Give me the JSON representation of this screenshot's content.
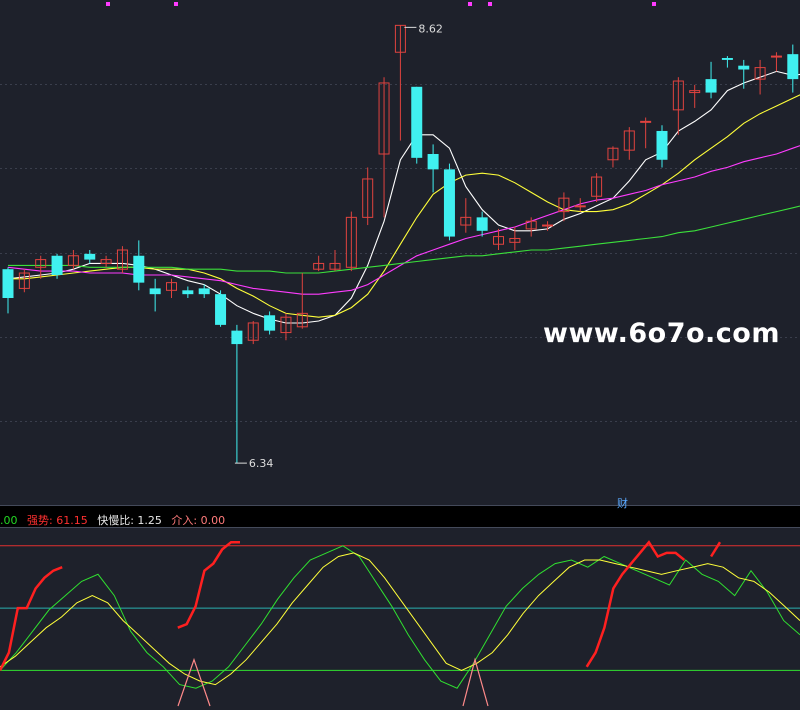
{
  "watermark": "www.6o7o.com",
  "main_panel": {
    "high_label": "8.62",
    "low_label": "6.34",
    "marker_label": "财",
    "marker_color": "#5aa9ff"
  },
  "indicator_panel": {
    "legend": [
      {
        "text": ".00",
        "color": "#23d723"
      },
      {
        "text": "强势: 61.15",
        "color": "#ff3030"
      },
      {
        "text": "快慢比: 1.25",
        "color": "#e8e8e8"
      },
      {
        "text": "介入: 0.00",
        "color": "#ff7b7b"
      }
    ]
  },
  "colors": {
    "background": "#000000",
    "bg_main": "#1e212b",
    "up": "#e0433f",
    "down": "#40f0f0",
    "ma5": "#ffffff",
    "ma10": "#ffff3a",
    "ma20": "#ff3cff",
    "ma60": "#3be03b",
    "strong": "#ff2020",
    "signal": "#ffff3a",
    "fast": "#30e030",
    "entry": "#ff8a8a",
    "hline_top": "#e03030",
    "hline_mid": "#2ab0b0",
    "hline_low": "#30e030"
  },
  "chart_data": {
    "type": "candlestick",
    "ylim": [
      6.2,
      8.7
    ],
    "candles": [
      [
        7.35,
        7.2,
        7.36,
        7.12
      ],
      [
        7.25,
        7.33,
        7.35,
        7.23
      ],
      [
        7.36,
        7.4,
        7.42,
        7.3
      ],
      [
        7.42,
        7.32,
        7.43,
        7.3
      ],
      [
        7.37,
        7.42,
        7.45,
        7.35
      ],
      [
        7.43,
        7.4,
        7.45,
        7.38
      ],
      [
        7.38,
        7.4,
        7.42,
        7.36
      ],
      [
        7.35,
        7.45,
        7.47,
        7.33
      ],
      [
        7.42,
        7.28,
        7.5,
        7.24
      ],
      [
        7.25,
        7.22,
        7.3,
        7.13
      ],
      [
        7.24,
        7.28,
        7.3,
        7.2
      ],
      [
        7.24,
        7.22,
        7.26,
        7.2
      ],
      [
        7.25,
        7.22,
        7.27,
        7.2
      ],
      [
        7.22,
        7.06,
        7.24,
        7.05
      ],
      [
        7.03,
        6.96,
        7.06,
        6.34
      ],
      [
        6.98,
        7.07,
        7.08,
        6.96
      ],
      [
        7.11,
        7.03,
        7.13,
        7.01
      ],
      [
        7.02,
        7.1,
        7.12,
        6.98
      ],
      [
        7.05,
        7.12,
        7.33,
        7.04
      ],
      [
        7.35,
        7.38,
        7.42,
        7.34
      ],
      [
        7.35,
        7.38,
        7.45,
        7.34
      ],
      [
        7.36,
        7.62,
        7.65,
        7.34
      ],
      [
        7.62,
        7.82,
        7.88,
        7.58
      ],
      [
        7.95,
        8.32,
        8.35,
        7.62
      ],
      [
        8.48,
        8.62,
        8.62,
        8.02
      ],
      [
        8.3,
        7.93,
        8.3,
        7.9
      ],
      [
        7.95,
        7.87,
        8.0,
        7.75
      ],
      [
        7.87,
        7.52,
        7.9,
        7.5
      ],
      [
        7.58,
        7.62,
        7.72,
        7.54
      ],
      [
        7.62,
        7.55,
        7.65,
        7.52
      ],
      [
        7.48,
        7.52,
        7.56,
        7.45
      ],
      [
        7.49,
        7.51,
        7.57,
        7.45
      ],
      [
        7.56,
        7.6,
        7.62,
        7.52
      ],
      [
        7.58,
        7.58,
        7.6,
        7.55
      ],
      [
        7.65,
        7.72,
        7.75,
        7.6
      ],
      [
        7.68,
        7.68,
        7.72,
        7.65
      ],
      [
        7.73,
        7.83,
        7.85,
        7.7
      ],
      [
        7.92,
        7.98,
        7.99,
        7.88
      ],
      [
        7.97,
        8.07,
        8.09,
        7.92
      ],
      [
        8.12,
        8.12,
        8.14,
        7.98
      ],
      [
        8.07,
        7.92,
        8.1,
        7.88
      ],
      [
        8.18,
        8.33,
        8.35,
        8.05
      ],
      [
        8.27,
        8.28,
        8.31,
        8.19
      ],
      [
        8.34,
        8.27,
        8.43,
        8.24
      ],
      [
        8.45,
        8.44,
        8.46,
        8.4
      ],
      [
        8.41,
        8.39,
        8.44,
        8.29
      ],
      [
        8.34,
        8.4,
        8.44,
        8.26
      ],
      [
        8.46,
        8.46,
        8.48,
        8.38
      ],
      [
        8.47,
        8.34,
        8.52,
        8.27
      ],
      [
        8.41,
        8.41,
        8.44,
        8.38
      ],
      [
        8.37,
        8.4,
        8.45,
        8.3
      ],
      [
        8.38,
        8.42,
        8.52,
        8.35
      ],
      [
        8.57,
        8.42,
        8.59,
        8.38
      ],
      [
        8.36,
        8.32,
        8.45,
        8.25
      ]
    ],
    "series": [
      {
        "name": "MA5",
        "color": "#ffffff",
        "values": [
          7.3,
          7.31,
          7.32,
          7.33,
          7.35,
          7.38,
          7.38,
          7.38,
          7.37,
          7.35,
          7.32,
          7.29,
          7.27,
          7.22,
          7.16,
          7.12,
          7.09,
          7.07,
          7.07,
          7.08,
          7.11,
          7.2,
          7.37,
          7.6,
          7.92,
          8.05,
          8.05,
          7.98,
          7.78,
          7.66,
          7.58,
          7.55,
          7.55,
          7.56,
          7.61,
          7.64,
          7.68,
          7.72,
          7.81,
          7.92,
          7.96,
          8.07,
          8.12,
          8.18,
          8.28,
          8.32,
          8.35,
          8.38,
          8.36,
          8.37,
          8.36,
          8.36,
          8.36,
          8.33
        ]
      },
      {
        "name": "MA10",
        "color": "#ffff3a",
        "values": [
          7.3,
          7.3,
          7.31,
          7.32,
          7.33,
          7.34,
          7.35,
          7.36,
          7.36,
          7.35,
          7.35,
          7.35,
          7.33,
          7.3,
          7.25,
          7.21,
          7.16,
          7.12,
          7.11,
          7.1,
          7.11,
          7.15,
          7.22,
          7.34,
          7.48,
          7.62,
          7.74,
          7.8,
          7.84,
          7.85,
          7.84,
          7.8,
          7.75,
          7.7,
          7.66,
          7.65,
          7.65,
          7.66,
          7.69,
          7.74,
          7.79,
          7.85,
          7.92,
          7.98,
          8.04,
          8.11,
          8.16,
          8.2,
          8.24,
          8.28,
          8.3,
          8.32,
          8.34,
          8.34
        ]
      },
      {
        "name": "MA20",
        "color": "#ff3cff",
        "values": [
          7.36,
          7.35,
          7.34,
          7.34,
          7.34,
          7.33,
          7.33,
          7.33,
          7.32,
          7.32,
          7.32,
          7.31,
          7.3,
          7.29,
          7.27,
          7.25,
          7.24,
          7.23,
          7.22,
          7.22,
          7.23,
          7.24,
          7.27,
          7.32,
          7.37,
          7.42,
          7.45,
          7.48,
          7.51,
          7.53,
          7.55,
          7.57,
          7.6,
          7.63,
          7.66,
          7.69,
          7.71,
          7.72,
          7.74,
          7.76,
          7.79,
          7.81,
          7.83,
          7.86,
          7.88,
          7.91,
          7.93,
          7.95,
          7.98,
          8.01,
          8.04,
          8.07,
          8.1,
          8.12
        ]
      },
      {
        "name": "MA60",
        "color": "#3be03b",
        "values": [
          7.37,
          7.37,
          7.37,
          7.37,
          7.37,
          7.36,
          7.36,
          7.36,
          7.36,
          7.36,
          7.36,
          7.35,
          7.35,
          7.35,
          7.34,
          7.34,
          7.34,
          7.33,
          7.33,
          7.33,
          7.34,
          7.35,
          7.36,
          7.37,
          7.38,
          7.39,
          7.4,
          7.41,
          7.42,
          7.42,
          7.43,
          7.44,
          7.45,
          7.45,
          7.46,
          7.47,
          7.48,
          7.49,
          7.5,
          7.51,
          7.52,
          7.54,
          7.55,
          7.57,
          7.59,
          7.61,
          7.63,
          7.65,
          7.67,
          7.69,
          7.71,
          7.72,
          7.74,
          7.76
        ]
      }
    ],
    "indicator": {
      "ylim": [
        0,
        100
      ],
      "hlines": [
        {
          "value": 90,
          "color": "#e03030"
        },
        {
          "value": 55,
          "color": "#2ab0b0"
        },
        {
          "value": 20,
          "color": "#30e030"
        }
      ],
      "strong": [
        20,
        30,
        55,
        55,
        66,
        72,
        76,
        78,
        null,
        null,
        null,
        null,
        null,
        null,
        null,
        null,
        null,
        null,
        null,
        null,
        44,
        46,
        56,
        76,
        80,
        88,
        92,
        92,
        null,
        null,
        null,
        null,
        null,
        null,
        null,
        null,
        null,
        null,
        null,
        null,
        null,
        null,
        null,
        null,
        null,
        null,
        null,
        null,
        null,
        null,
        null,
        null,
        null,
        null,
        null,
        null,
        null,
        null,
        null,
        null,
        null,
        null,
        null,
        null,
        null,
        null,
        22,
        30,
        44,
        66,
        74,
        80,
        86,
        92,
        84,
        86,
        86,
        82,
        null,
        null,
        84,
        92,
        null,
        null,
        null,
        null,
        null,
        null,
        null,
        null,
        null
      ],
      "signal": [
        22,
        28,
        36,
        44,
        50,
        58,
        62,
        58,
        48,
        40,
        32,
        24,
        18,
        14,
        12,
        18,
        26,
        36,
        46,
        58,
        68,
        78,
        84,
        86,
        82,
        72,
        60,
        48,
        36,
        24,
        20,
        24,
        30,
        40,
        52,
        62,
        70,
        78,
        82,
        82,
        80,
        78,
        76,
        74,
        76,
        78,
        80,
        78,
        72,
        70,
        64,
        56,
        48
      ],
      "fast": [
        20,
        30,
        42,
        54,
        62,
        70,
        74,
        62,
        42,
        30,
        22,
        12,
        10,
        14,
        22,
        34,
        46,
        60,
        72,
        82,
        86,
        90,
        84,
        70,
        56,
        40,
        26,
        14,
        10,
        24,
        40,
        56,
        66,
        74,
        80,
        82,
        78,
        84,
        80,
        76,
        72,
        68,
        82,
        74,
        70,
        62,
        76,
        64,
        48,
        40
      ],
      "entry": [
        0,
        0,
        0,
        0,
        0,
        0,
        0,
        0,
        0,
        0,
        0,
        0,
        0,
        0,
        0,
        0,
        0,
        0,
        0,
        0,
        0,
        0,
        0,
        0,
        0,
        0,
        0,
        0,
        0,
        0,
        0,
        0,
        0,
        0,
        0,
        0,
        0,
        0,
        0,
        0,
        0,
        0,
        0,
        0,
        0,
        0,
        0,
        0,
        0,
        0,
        0,
        0,
        0,
        0,
        0,
        0,
        0,
        0,
        0,
        0,
        0,
        0,
        0,
        0,
        0,
        0,
        0,
        0,
        0,
        0,
        0,
        0,
        0,
        0,
        0,
        0,
        0,
        0,
        0,
        0,
        0,
        0,
        0,
        0,
        0,
        0,
        0,
        0,
        0,
        0,
        0,
        0,
        0,
        0,
        0,
        0,
        0,
        0,
        0,
        0
      ]
    }
  }
}
